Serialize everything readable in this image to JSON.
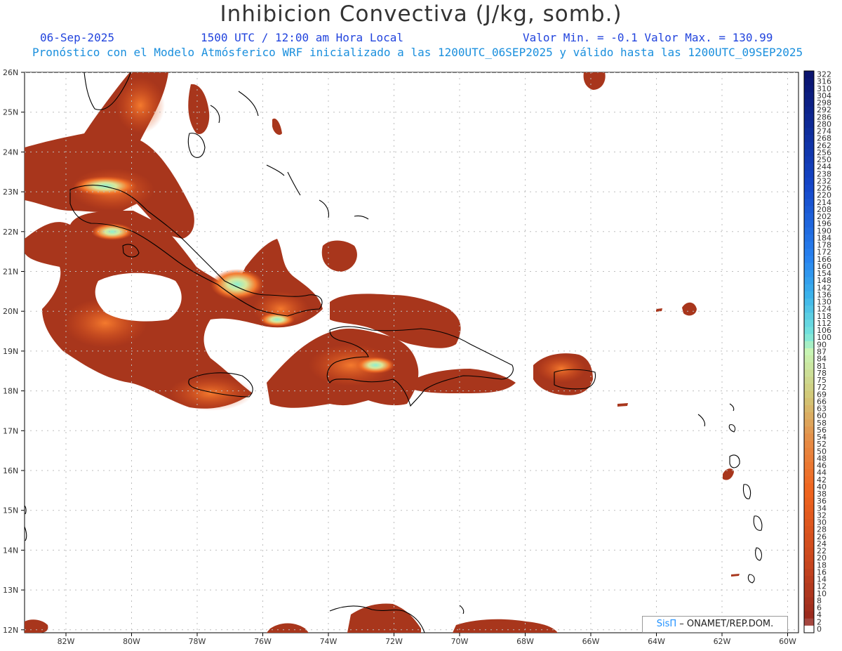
{
  "header": {
    "title": "Inhibicion Convectiva (J/kg, somb.)",
    "date": "06-Sep-2025",
    "time": "1500 UTC / 12:00 am Hora Local",
    "minmax": "Valor Min. = -0.1  Valor Max. = 130.99",
    "model_line": "Pronóstico con el Modelo Atmósferico WRF inicializado a las 1200UTC_06SEP2025 y válido hasta las  1200UTC_09SEP2025"
  },
  "axes": {
    "lat_labels": [
      "26N",
      "25N",
      "24N",
      "23N",
      "22N",
      "21N",
      "20N",
      "19N",
      "18N",
      "17N",
      "16N",
      "15N",
      "14N",
      "13N",
      "12N"
    ],
    "lon_labels": [
      "82W",
      "80W",
      "78W",
      "76W",
      "74W",
      "72W",
      "70W",
      "68W",
      "66W",
      "64W",
      "62W",
      "60W"
    ]
  },
  "colorbar": {
    "labels": [
      "322",
      "316",
      "310",
      "304",
      "298",
      "292",
      "286",
      "280",
      "274",
      "268",
      "262",
      "256",
      "250",
      "244",
      "238",
      "232",
      "226",
      "220",
      "214",
      "208",
      "202",
      "196",
      "190",
      "184",
      "178",
      "172",
      "166",
      "160",
      "154",
      "148",
      "142",
      "136",
      "130",
      "124",
      "118",
      "112",
      "106",
      "100",
      "90",
      "87",
      "84",
      "81",
      "78",
      "75",
      "72",
      "69",
      "66",
      "63",
      "60",
      "58",
      "56",
      "54",
      "52",
      "50",
      "48",
      "46",
      "44",
      "42",
      "40",
      "38",
      "36",
      "34",
      "32",
      "30",
      "28",
      "26",
      "24",
      "22",
      "20",
      "18",
      "16",
      "14",
      "12",
      "10",
      "8",
      "6",
      "4",
      "2",
      "0"
    ]
  },
  "credit": {
    "brand": "SisΠ",
    "text": "– ONAMET/REP.DOM."
  },
  "colors": {
    "field_dark": "#a8361c",
    "field_mid": "#e2561c",
    "field_light": "#f47a2e",
    "field_peak": "#8ff0cf",
    "grid": "#bdbdbd",
    "coast": "#000000"
  }
}
